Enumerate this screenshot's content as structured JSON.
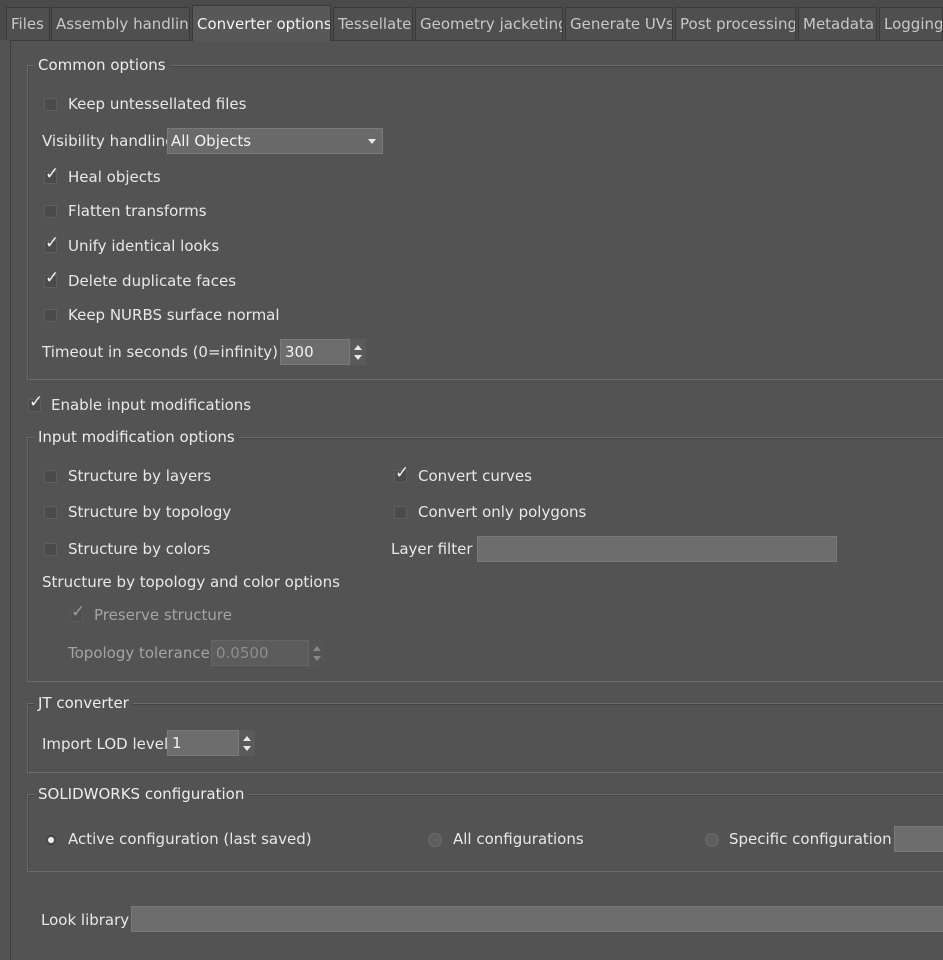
{
  "tabs": [
    {
      "label": "Files",
      "active": false
    },
    {
      "label": "Assembly handling",
      "active": false
    },
    {
      "label": "Converter options",
      "active": true
    },
    {
      "label": "Tessellate",
      "active": false
    },
    {
      "label": "Geometry jacketing",
      "active": false
    },
    {
      "label": "Generate UVs",
      "active": false
    },
    {
      "label": "Post processing",
      "active": false
    },
    {
      "label": "Metadata",
      "active": false
    },
    {
      "label": "Logging",
      "active": false
    }
  ],
  "common": {
    "title": "Common options",
    "keep_untessellated": {
      "label": "Keep untessellated files",
      "checked": false
    },
    "visibility_label": "Visibility handling",
    "visibility_value": "All Objects",
    "heal_objects": {
      "label": "Heal objects",
      "checked": true
    },
    "flatten_transforms": {
      "label": "Flatten transforms",
      "checked": false
    },
    "unify_looks": {
      "label": "Unify identical looks",
      "checked": true
    },
    "delete_duplicate": {
      "label": "Delete duplicate faces",
      "checked": true
    },
    "keep_nurbs": {
      "label": "Keep NURBS surface normal",
      "checked": false
    },
    "timeout_label": "Timeout in seconds (0=infinity)",
    "timeout_value": "300"
  },
  "enable_input_mod": {
    "label": "Enable input modifications",
    "checked": true
  },
  "input_mod": {
    "title": "Input modification options",
    "structure_layers": {
      "label": "Structure by layers",
      "checked": false
    },
    "structure_topology": {
      "label": "Structure by topology",
      "checked": false
    },
    "structure_colors": {
      "label": "Structure by colors",
      "checked": false
    },
    "convert_curves": {
      "label": "Convert curves",
      "checked": true
    },
    "convert_polygons": {
      "label": "Convert only polygons",
      "checked": false
    },
    "layer_filter_label": "Layer filter",
    "layer_filter_value": "",
    "topo_color_heading": "Structure by topology and color options",
    "preserve_structure": {
      "label": "Preserve structure",
      "checked": true
    },
    "topology_tolerance_label": "Topology tolerance",
    "topology_tolerance_value": "0.0500"
  },
  "jt": {
    "title": "JT converter",
    "lod_label": "Import LOD level",
    "lod_value": "1"
  },
  "solidworks": {
    "title": "SOLIDWORKS configuration",
    "options": [
      {
        "label": "Active configuration (last saved)",
        "selected": true
      },
      {
        "label": "All configurations",
        "selected": false
      },
      {
        "label": "Specific configuration",
        "selected": false
      }
    ],
    "specific_value": ""
  },
  "look_library": {
    "label": "Look library",
    "value": ""
  },
  "colors": {
    "background": "#535353",
    "text": "#e6e6e6",
    "field": "#6d6d6d"
  }
}
